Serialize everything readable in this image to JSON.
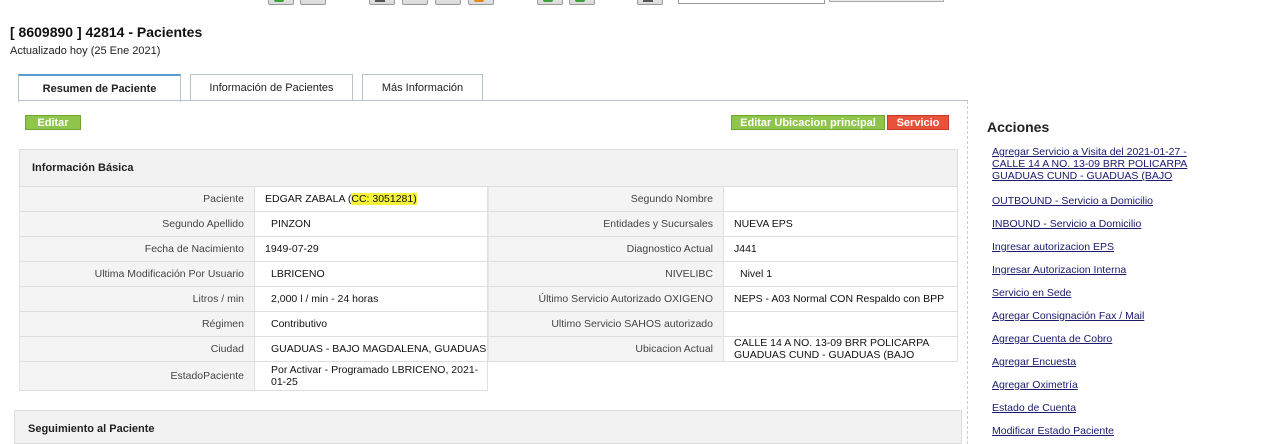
{
  "page": {
    "title": "[ 8609890 ] 42814 - Pacientes",
    "updated": "Actualizado hoy (25 Ene 2021)"
  },
  "tabs": [
    {
      "label": "Resumen de Paciente",
      "active": true
    },
    {
      "label": "Información de Pacientes",
      "active": false
    },
    {
      "label": "Más Información",
      "active": false
    }
  ],
  "buttons": {
    "edit": "Editar",
    "ubicacion": "Editar Ubicacion principal",
    "servicio": "Servicio"
  },
  "colors": {
    "green_button": "#8fc54a",
    "red_button": "#e8523a",
    "highlight": "#f5f23a",
    "link": "#1a1a6e"
  },
  "basic_info": {
    "title": "Información Básica",
    "left": [
      {
        "label": "Paciente",
        "value": "EDGAR ZABALA (",
        "value_hl": "CC: 3051281)"
      },
      {
        "label": "Segundo Apellido",
        "value": "PINZON"
      },
      {
        "label": "Fecha de Nacimiento",
        "value": "1949-07-29"
      },
      {
        "label": "Ultima Modificación Por Usuario",
        "value": "LBRICENO"
      },
      {
        "label": "Litros / min",
        "value": "2,000 l / min - 24 horas"
      },
      {
        "label": "Régimen",
        "value": "Contributivo"
      },
      {
        "label": "Ciudad",
        "value": "GUADUAS - BAJO MAGDALENA, GUADUAS"
      },
      {
        "label": "EstadoPaciente",
        "value": "Por Activar - Programado LBRICENO, 2021-01-25"
      }
    ],
    "right": [
      {
        "label": "Segundo Nombre",
        "value": ""
      },
      {
        "label": "Entidades y Sucursales",
        "value": "NUEVA EPS"
      },
      {
        "label": "Diagnostico Actual",
        "value": "J441"
      },
      {
        "label": "NIVELIBC",
        "value": "Nivel 1"
      },
      {
        "label": "Último Servicio Autorizado OXIGENO",
        "value": "NEPS - A03 Normal CON Respaldo con BPP"
      },
      {
        "label": "Ultimo Servicio SAHOS autorizado",
        "value": ""
      },
      {
        "label": "Ubicacion Actual",
        "value": "CALLE 14 A NO. 13-09 BRR POLICARPA GUADUAS CUND - GUADUAS (BAJO"
      }
    ]
  },
  "followup": {
    "title": "Seguimiento al Paciente"
  },
  "actions": {
    "title": "Acciones",
    "items": [
      "Agregar Servicio a Visita del 2021-01-27 - CALLE 14 A NO. 13-09 BRR POLICARPA GUADUAS CUND - GUADUAS (BAJO",
      "OUTBOUND - Servicio a Domicilio",
      "INBOUND - Servicio a Domicilio",
      "Ingresar autorizacion EPS",
      "Ingresar Autorizacion Interna",
      "Servicio en Sede",
      "Agregar Consignación Fax / Mail",
      "Agregar Cuenta de Cobro",
      "Agregar Encuesta",
      "Agregar Oximetría",
      "Estado de Cuenta",
      "Modificar Estado Paciente"
    ]
  }
}
